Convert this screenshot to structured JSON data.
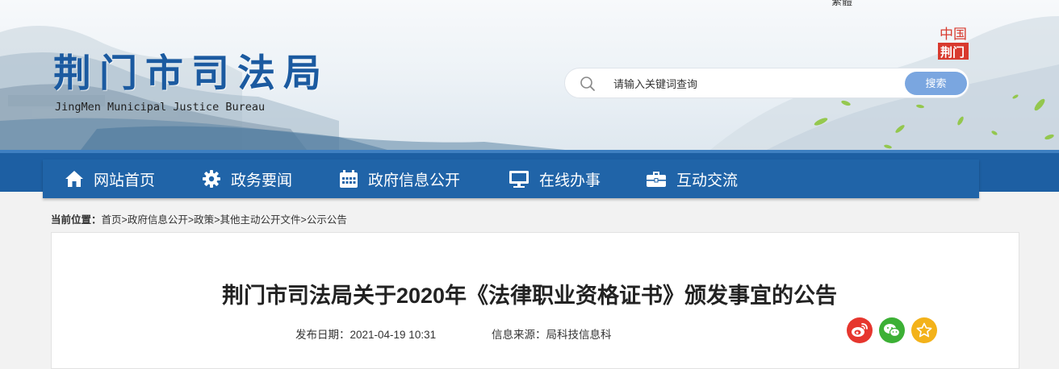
{
  "header": {
    "cut_text": "繁體",
    "title": "荆门市司法局",
    "subtitle": "JingMen Municipal Justice Bureau",
    "logo_text_top": "中国",
    "logo_text_bottom": "荆门"
  },
  "search": {
    "placeholder": "请输入关键词查询",
    "button_label": "搜索"
  },
  "nav": {
    "items": [
      {
        "label": "网站首页",
        "icon": "home-icon"
      },
      {
        "label": "政务要闻",
        "icon": "gear-icon"
      },
      {
        "label": "政府信息公开",
        "icon": "calendar-icon"
      },
      {
        "label": "在线办事",
        "icon": "monitor-icon"
      },
      {
        "label": "互动交流",
        "icon": "briefcase-icon"
      }
    ]
  },
  "breadcrumb": {
    "lead": "当前位置：",
    "items": [
      "首页",
      "政府信息公开",
      "政策",
      "其他主动公开文件",
      "公示公告"
    ],
    "separator": ">"
  },
  "article": {
    "title": "荆门市司法局关于2020年《法律职业资格证书》颁发事宜的公告",
    "published_label": "发布日期：",
    "published_value": "2021-04-19 10:31",
    "source_label": "信息来源：",
    "source_value": "局科技信息科"
  },
  "share": {
    "items": [
      {
        "icon": "weibo-icon",
        "color": "#e6362e"
      },
      {
        "icon": "wechat-icon",
        "color": "#3cb035"
      },
      {
        "icon": "favorite-star-icon",
        "color": "#f3b21a"
      }
    ]
  },
  "colors": {
    "brand_blue": "#1d5fa3",
    "title_blue": "#1b5aa0",
    "search_button": "#7aa6e0"
  }
}
